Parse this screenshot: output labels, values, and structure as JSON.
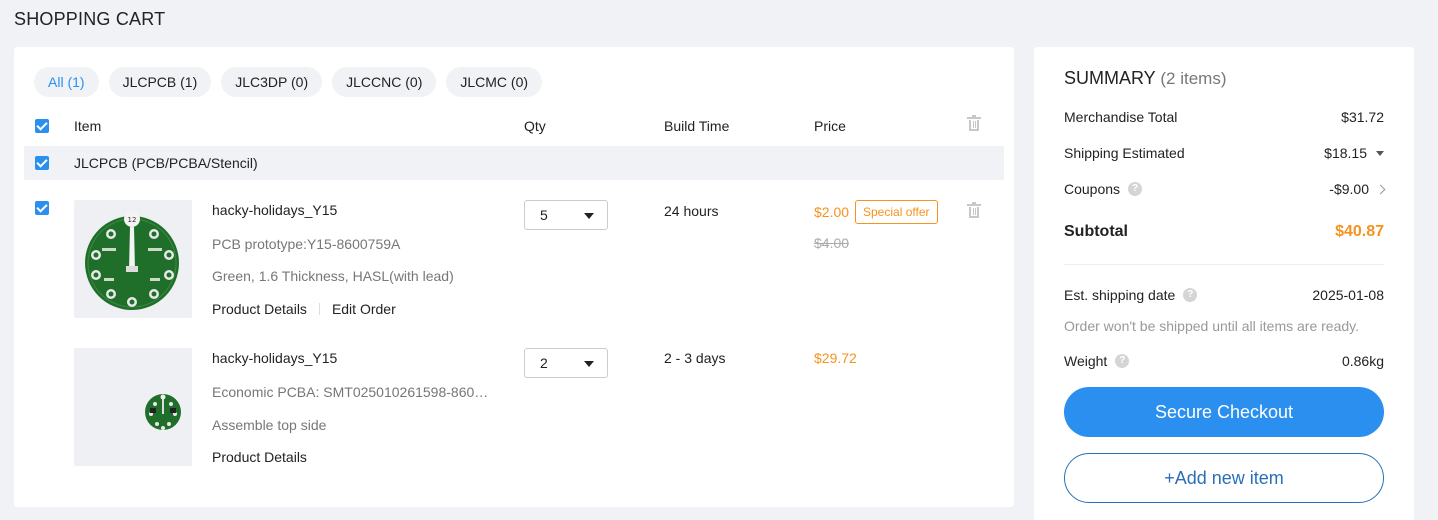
{
  "page": {
    "title": "SHOPPING CART"
  },
  "tabs": [
    {
      "label": "All  (1)"
    },
    {
      "label": "JLCPCB  (1)"
    },
    {
      "label": "JLC3DP  (0)"
    },
    {
      "label": "JLCCNC  (0)"
    },
    {
      "label": "JLCMC  (0)"
    }
  ],
  "table": {
    "headers": {
      "item": "Item",
      "qty": "Qty",
      "build_time": "Build Time",
      "price": "Price"
    }
  },
  "group": {
    "label": "JLCPCB (PCB/PCBA/Stencil)"
  },
  "items": [
    {
      "name": "hacky-holidays_Y15",
      "line1": "PCB prototype:Y15-8600759A",
      "line2": "Green, 1.6 Thickness, HASL(with lead)",
      "details_link": "Product Details",
      "edit_link": "Edit Order",
      "qty": "5",
      "build_time": "24 hours",
      "price": "$2.00",
      "badge": "Special offer",
      "old_price": "$4.00",
      "thumb_label": "12"
    },
    {
      "name": "hacky-holidays_Y15",
      "line1": "Economic PCBA: SMT025010261598-860…",
      "line2": "Assemble top side",
      "details_link": "Product Details",
      "qty": "2",
      "build_time": "2 - 3 days",
      "price": "$29.72"
    }
  ],
  "summary": {
    "title": "SUMMARY",
    "count": "(2 items)",
    "merch_label": "Merchandise Total",
    "merch_value": "$31.72",
    "ship_label": "Shipping Estimated",
    "ship_value": "$18.15",
    "coupons_label": "Coupons",
    "coupons_value": "-$9.00",
    "subtotal_label": "Subtotal",
    "subtotal_value": "$40.87",
    "est_label": "Est. shipping date",
    "est_value": "2025-01-08",
    "note": "Order won't be shipped until all items are ready.",
    "weight_label": "Weight",
    "weight_value": "0.86kg",
    "checkout_label": "Secure Checkout",
    "add_label": "+Add new item"
  },
  "colors": {
    "accent": "#2b8ff0",
    "price": "#f6921e",
    "pcb_green": "#1f6f2a"
  },
  "icons": [
    "checkbox-checked-icon",
    "trash-icon",
    "caret-down-icon",
    "help-icon",
    "chevron-right-icon"
  ]
}
